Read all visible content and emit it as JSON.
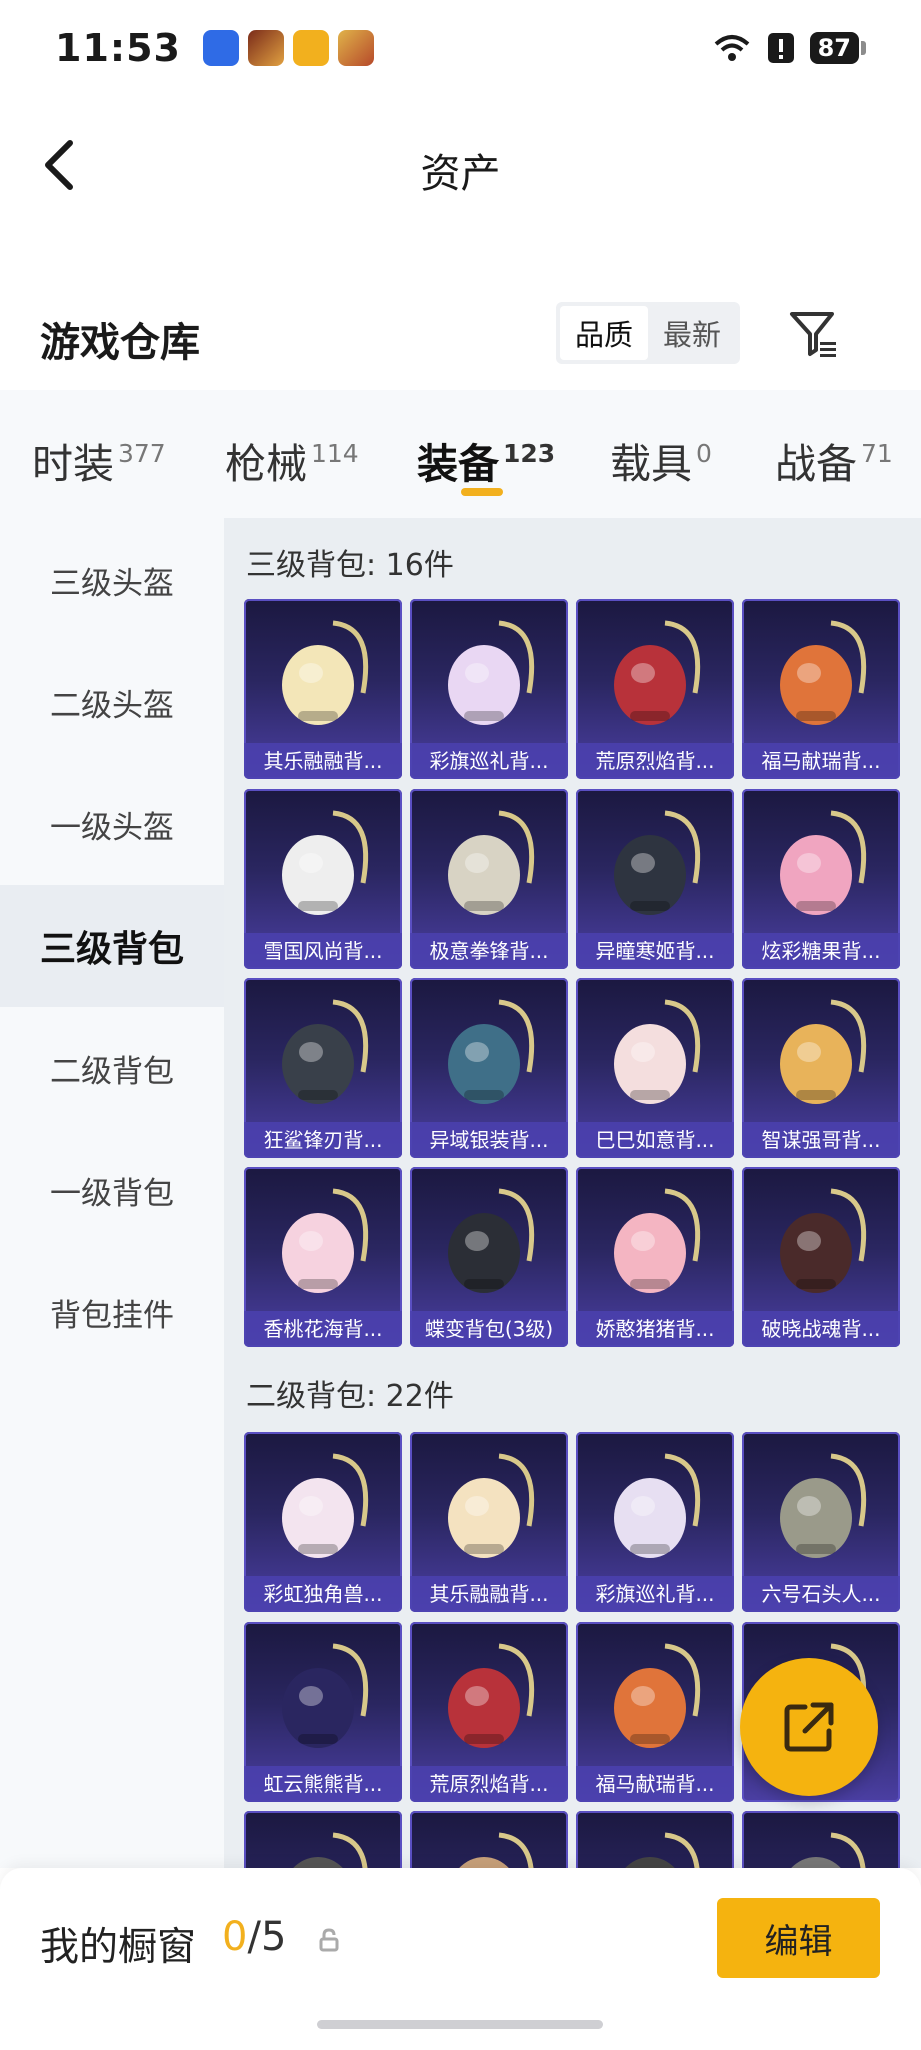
{
  "status_bar": {
    "time": "11:53",
    "battery": "87",
    "app_icons": [
      "lightbulb-app-icon",
      "game-hero-app-icon",
      "target-app-icon",
      "peace-elite-app-icon"
    ],
    "icons": [
      "wifi-icon",
      "alert-icon",
      "battery-icon"
    ]
  },
  "nav": {
    "back_icon": "chevron-left-icon",
    "title": "资产"
  },
  "warehouse": {
    "title": "游戏仓库",
    "sort_options": [
      "品质",
      "最新"
    ],
    "active_sort": "品质",
    "filter_icon": "filter-icon"
  },
  "tabs": [
    {
      "label": "时装",
      "count": "377"
    },
    {
      "label": "枪械",
      "count": "114"
    },
    {
      "label": "装备",
      "count": "123",
      "active": true
    },
    {
      "label": "载具",
      "count": "0"
    },
    {
      "label": "战备",
      "count": "71"
    }
  ],
  "sidebar": {
    "items": [
      "三级头盔",
      "二级头盔",
      "一级头盔",
      "三级背包",
      "二级背包",
      "一级背包",
      "背包挂件"
    ],
    "active": "三级背包"
  },
  "sections": [
    {
      "title": "三级背包: 16件",
      "items": [
        {
          "name": "其乐融融背...",
          "color": "#f3e6b8"
        },
        {
          "name": "彩旗巡礼背...",
          "color": "#e9d7f3"
        },
        {
          "name": "荒原烈焰背...",
          "color": "#b8323a"
        },
        {
          "name": "福马献瑞背...",
          "color": "#e0743a"
        },
        {
          "name": "雪国风尚背...",
          "color": "#eeeeee"
        },
        {
          "name": "极意拳锋背...",
          "color": "#d8d3c4"
        },
        {
          "name": "异瞳寒姬背...",
          "color": "#2e3440"
        },
        {
          "name": "炫彩糖果背...",
          "color": "#f0a5c0"
        },
        {
          "name": "狂鲨锋刃背...",
          "color": "#39404a"
        },
        {
          "name": "异域银装背...",
          "color": "#3f6f88"
        },
        {
          "name": "巳巳如意背...",
          "color": "#f4dede"
        },
        {
          "name": "智谋强哥背...",
          "color": "#e8b35a"
        },
        {
          "name": "香桃花海背...",
          "color": "#f6d2df"
        },
        {
          "name": "蝶变背包(3级)",
          "color": "#2b2e36"
        },
        {
          "name": "娇憨猪猪背...",
          "color": "#f4b5c2"
        },
        {
          "name": "破晓战魂背...",
          "color": "#4a2a2a"
        }
      ]
    },
    {
      "title": "二级背包: 22件",
      "items": [
        {
          "name": "彩虹独角兽...",
          "color": "#f3e4ef"
        },
        {
          "name": "其乐融融背...",
          "color": "#f4e2c0"
        },
        {
          "name": "彩旗巡礼背...",
          "color": "#e7dff2"
        },
        {
          "name": "六号石头人...",
          "color": "#9a9a8a"
        },
        {
          "name": "虹云熊熊背...",
          "color": "#2a2660"
        },
        {
          "name": "荒原烈焰背...",
          "color": "#b8323a"
        },
        {
          "name": "福马献瑞背...",
          "color": "#e0743a"
        },
        {
          "name": "",
          "color": "#7c7a74"
        },
        {
          "name": "",
          "color": "#555555"
        },
        {
          "name": "",
          "color": "#c7a07a"
        },
        {
          "name": "",
          "color": "#444444"
        },
        {
          "name": "",
          "color": "#777777"
        }
      ]
    }
  ],
  "fab_icon": "share-external-icon",
  "bottom_bar": {
    "showcase_label": "我的橱窗",
    "current": "0",
    "separator": "/",
    "total": "5",
    "lock_icon": "lock-icon",
    "edit_label": "编辑"
  }
}
